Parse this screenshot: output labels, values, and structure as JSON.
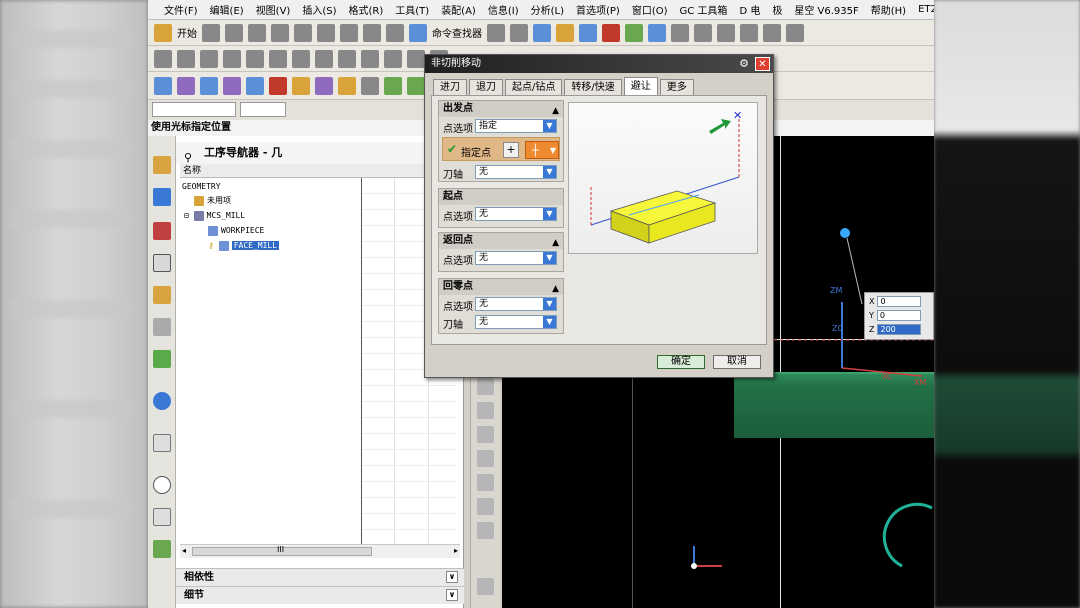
{
  "menu": {
    "items": [
      "文件(F)",
      "编辑(E)",
      "视图(V)",
      "插入(S)",
      "格式(R)",
      "工具(T)",
      "装配(A)",
      "信息(I)",
      "分析(L)",
      "首选项(P)",
      "窗口(O)",
      "GC 工具箱",
      "D 电",
      "极",
      "星空 V6.935F",
      "帮助(H)",
      "ET2008"
    ]
  },
  "toolbar": {
    "start_label": "开始",
    "command_finder_label": "命令查找器"
  },
  "status": {
    "prompt": "使用光标指定位置"
  },
  "navigator": {
    "title": "工序导航器 - 几",
    "column_name": "名称",
    "tree": [
      {
        "label": "GEOMETRY",
        "depth": 0
      },
      {
        "label": "未用项",
        "depth": 1
      },
      {
        "label": "MCS_MILL",
        "depth": 1
      },
      {
        "label": "WORKPIECE",
        "depth": 2
      },
      {
        "label": "FACE_MILL",
        "depth": 2,
        "selected": true
      }
    ],
    "scroll_grip": "III",
    "panels": [
      "相依性",
      "细节"
    ]
  },
  "dialog": {
    "title": "非切削移动",
    "tabs": [
      "进刀",
      "退刀",
      "起点/钻点",
      "转移/快速",
      "避让",
      "更多"
    ],
    "active_tab": "避让",
    "sections": [
      {
        "title": "出发点",
        "rows": [
          {
            "label": "点选项",
            "value": "指定"
          },
          {
            "label": "指定点",
            "type": "specify"
          },
          {
            "label": "刀轴",
            "value": "无"
          }
        ]
      },
      {
        "title": "起点",
        "rows": [
          {
            "label": "点选项",
            "value": "无"
          }
        ]
      },
      {
        "title": "返回点",
        "rows": [
          {
            "label": "点选项",
            "value": "无"
          }
        ]
      },
      {
        "title": "回零点",
        "rows": [
          {
            "label": "点选项",
            "value": "无"
          },
          {
            "label": "刀轴",
            "value": "无"
          }
        ]
      }
    ],
    "ok_label": "确定",
    "cancel_label": "取消"
  },
  "viewport": {
    "coords": [
      {
        "axis": "X",
        "value": "0"
      },
      {
        "axis": "Y",
        "value": "0"
      },
      {
        "axis": "Z",
        "value": "200"
      }
    ],
    "labels": {
      "zm": "ZM",
      "zc": "ZC",
      "xm": "XM",
      "xc": "XC"
    }
  },
  "colors": {
    "selection": "#316ac5",
    "model_green": "#227046",
    "preview_block": "#f2f20a",
    "close_red": "#e04030"
  }
}
